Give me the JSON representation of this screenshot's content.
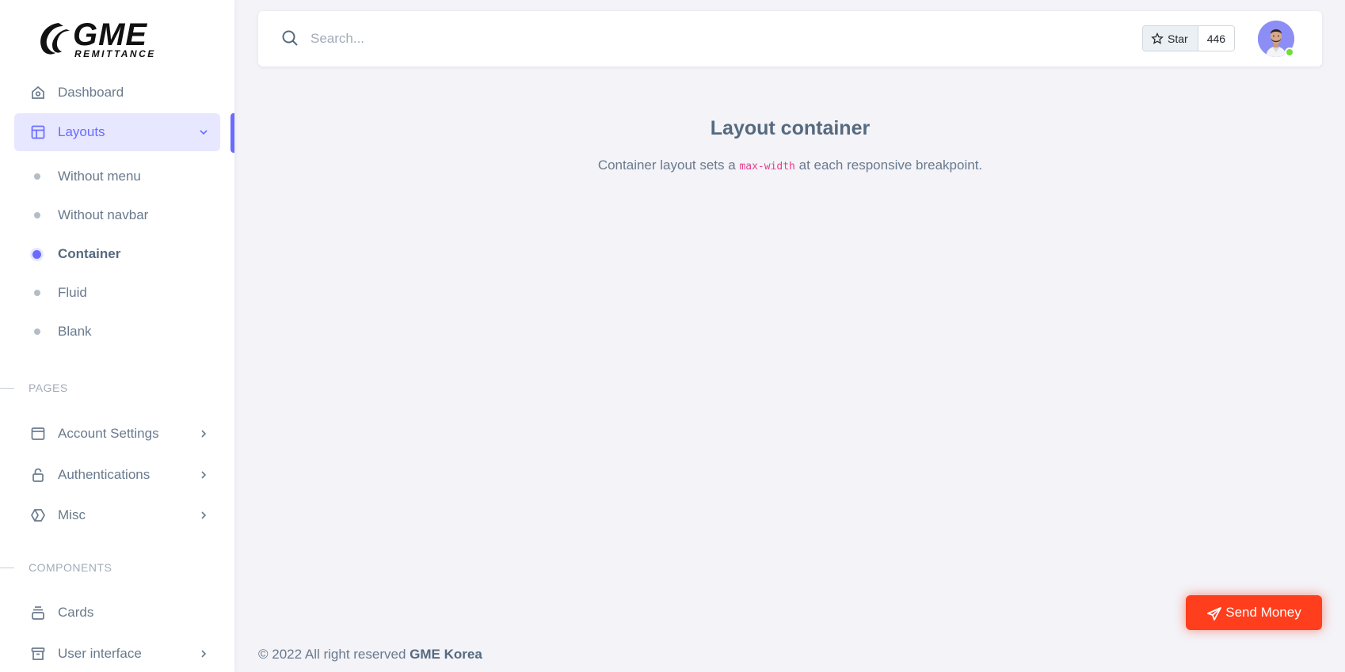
{
  "brand": {
    "name": "GME",
    "tagline": "REMITTANCE"
  },
  "sidebar": {
    "dashboard": "Dashboard",
    "layouts": "Layouts",
    "layout_items": [
      "Without menu",
      "Without navbar",
      "Container",
      "Fluid",
      "Blank"
    ],
    "section_pages": "PAGES",
    "account_settings": "Account Settings",
    "authentications": "Authentications",
    "misc": "Misc",
    "section_components": "COMPONENTS",
    "cards": "Cards",
    "user_interface": "User interface"
  },
  "navbar": {
    "search_placeholder": "Search...",
    "star_label": "Star",
    "star_count": "446"
  },
  "content": {
    "title": "Layout container",
    "desc_before": "Container layout sets a ",
    "desc_code": "max-width",
    "desc_after": " at each responsive breakpoint."
  },
  "footer": {
    "prefix": "© 2022 All right reserved ",
    "company": "GME Korea"
  },
  "send_money": "Send Money",
  "colors": {
    "accent": "#696cff",
    "send": "#ff3e1d",
    "online": "#71dd37"
  }
}
